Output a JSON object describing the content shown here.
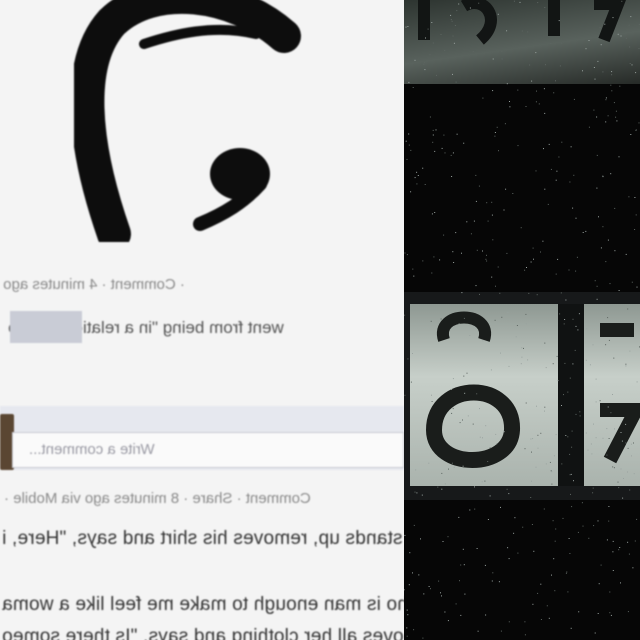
{
  "feed": {
    "meta_line_1": "· Comment · 4 minutes ago · ",
    "status_line": "went from being \"in a relationship\" to",
    "comment_placeholder": "Write a comment...",
    "meta_line_2": "Comment · Share · 8 minutes ago via Mobile · ",
    "post_line_1": "n stands up, removes his shirt and says, \"Here, i",
    "post_line_2": "who is man enough to make me feel like a woma",
    "post_line_3": "moves all her clothing and says, \"Is there someo"
  },
  "colors": {
    "page_background": "#f4f4f4",
    "ink": "#111111",
    "redaction": "#c9ccd6",
    "dark_panel": "#060606",
    "plate": "#c7cfc9"
  }
}
